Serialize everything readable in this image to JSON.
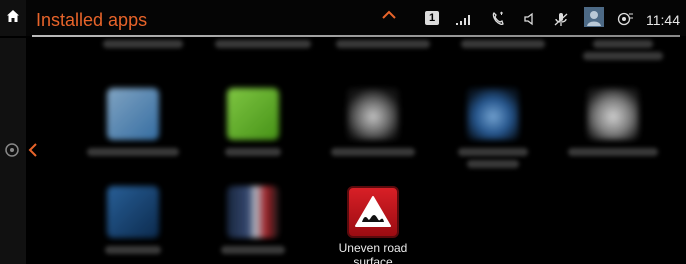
{
  "header": {
    "title": "Installed apps",
    "icons": [
      "home-icon",
      "chevron-up-icon",
      "signal-icon",
      "phone-icon",
      "speaker-icon",
      "mic-off-icon",
      "profile-icon",
      "connected-drive-icon"
    ],
    "badge": "1",
    "clock": "11:44",
    "accent_color": "#e8642a"
  },
  "left_rail": {
    "icons": [
      "settings-icon",
      "chevron-left-icon"
    ]
  },
  "apps": {
    "visible_item": {
      "label": "Uneven road surface",
      "icon": "uneven-road-warning-icon",
      "colors": {
        "tile": "#d81f26",
        "triangle": "#ffffff"
      }
    }
  }
}
